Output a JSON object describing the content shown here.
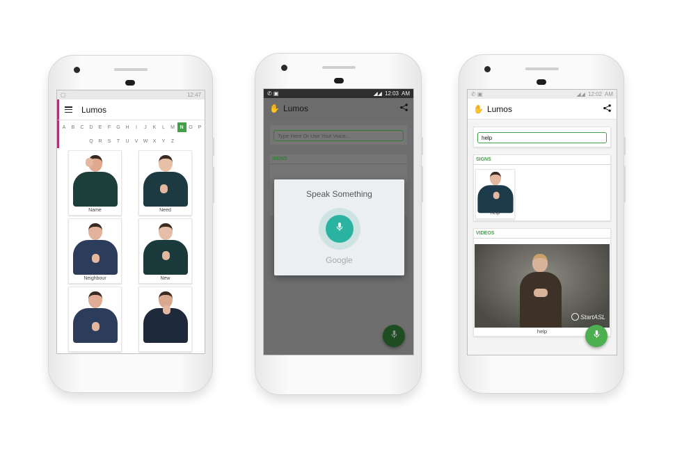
{
  "phone1": {
    "status_time": "12:47",
    "app_title": "Lumos",
    "alphabet_row1": [
      "A",
      "B",
      "C",
      "D",
      "E",
      "F",
      "G",
      "H",
      "I",
      "J",
      "K",
      "L",
      "M",
      "N",
      "O",
      "P"
    ],
    "alphabet_row2": [
      "Q",
      "R",
      "S",
      "T",
      "U",
      "V",
      "W",
      "X",
      "Y",
      "Z"
    ],
    "active_letter": "N",
    "signs": [
      {
        "label": "Name"
      },
      {
        "label": "Need"
      },
      {
        "label": "Neighbour"
      },
      {
        "label": "New"
      },
      {
        "label": ""
      },
      {
        "label": ""
      }
    ]
  },
  "phone2": {
    "status_time": "12:03",
    "status_ampm": "AM",
    "app_title": "Lumos",
    "search_placeholder": "Type Here Or Use Your Voice...",
    "signs_heading": "SIGNS",
    "dialog_title": "Speak Something",
    "dialog_brand": "Google"
  },
  "phone3": {
    "status_time": "12:02",
    "status_ampm": "AM",
    "app_title": "Lumos",
    "search_value": "help",
    "signs_heading": "SIGNS",
    "sign_label": "help",
    "videos_heading": "VIDEOS",
    "video_label": "help",
    "video_watermark": "StartASL"
  },
  "colors": {
    "accent_green": "#43a047",
    "mic_teal": "#2bb3a2"
  },
  "icons": [
    "menu-icon",
    "hand-icon",
    "share-icon",
    "mic-icon"
  ]
}
